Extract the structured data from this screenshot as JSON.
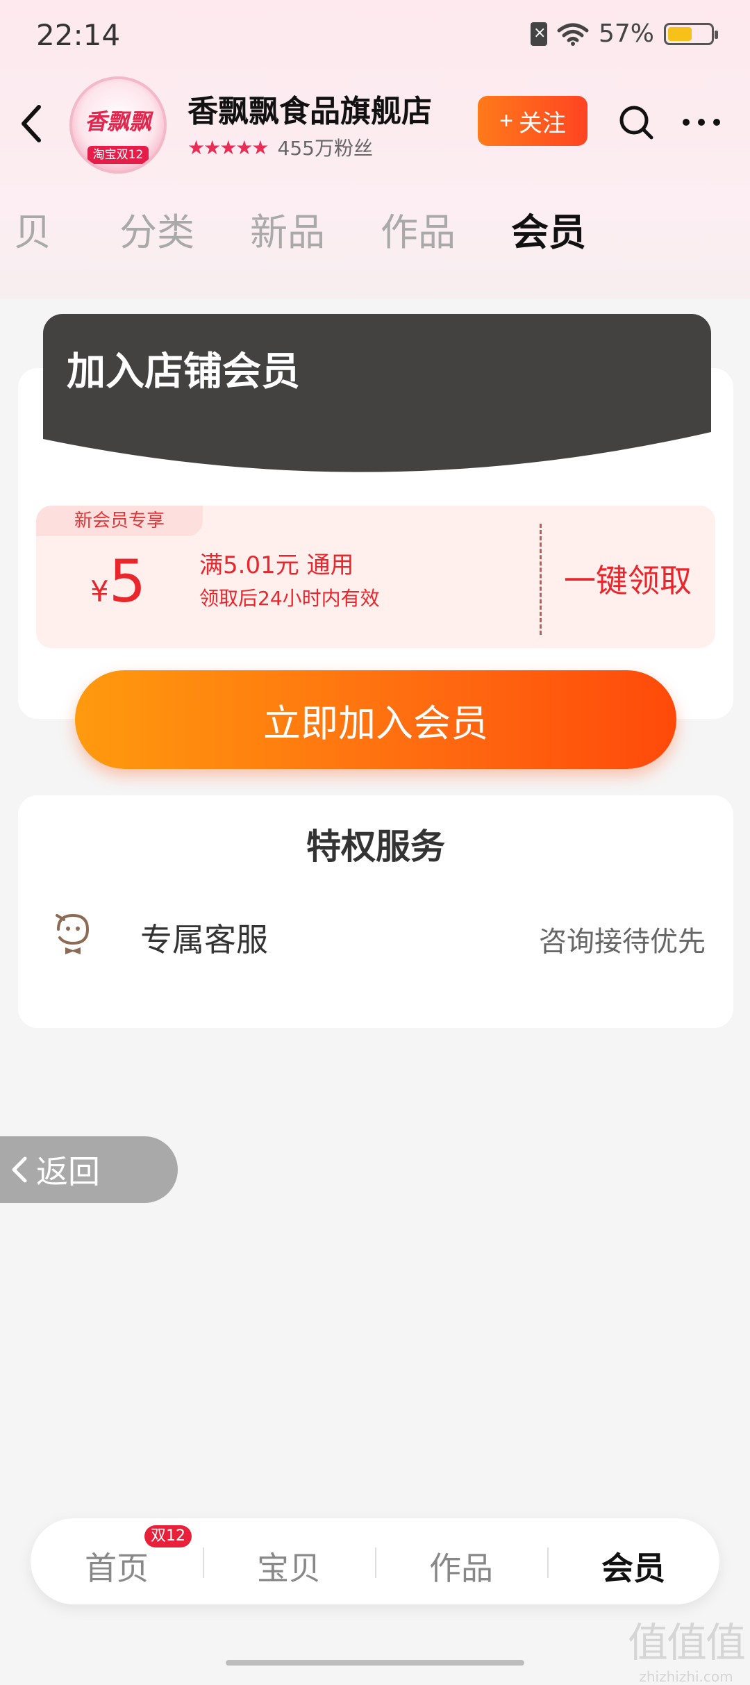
{
  "status_bar": {
    "time": "22:14",
    "battery_percent": "57%",
    "battery_level": 0.57,
    "icons": [
      "sim-error-icon",
      "wifi-icon",
      "battery-icon"
    ]
  },
  "store": {
    "logo_text": "香飘飘",
    "logo_badge": "淘宝双12",
    "name": "香飘飘食品旗舰店",
    "rating_stars": 5,
    "fans": "455万粉丝",
    "follow_label": "关注",
    "follow_prefix": "+"
  },
  "tabs": [
    {
      "label": "贝",
      "active": false
    },
    {
      "label": "分类",
      "active": false
    },
    {
      "label": "新品",
      "active": false
    },
    {
      "label": "作品",
      "active": false
    },
    {
      "label": "会员",
      "active": true
    }
  ],
  "join": {
    "banner_title": "加入店铺会员",
    "coupon": {
      "tag": "新会员专享",
      "currency": "¥",
      "amount": "5",
      "condition": "满5.01元 通用",
      "validity": "领取后24小时内有效",
      "claim_label": "一键领取"
    },
    "join_button": "立即加入会员"
  },
  "privileges": {
    "title": "特权服务",
    "items": [
      {
        "name": "专属客服",
        "desc": "咨询接待优先",
        "icon": "customer-service-icon"
      }
    ]
  },
  "float_back": "返回",
  "bottom_nav": {
    "items": [
      {
        "label": "首页",
        "badge": "双12",
        "active": false
      },
      {
        "label": "宝贝",
        "active": false
      },
      {
        "label": "作品",
        "active": false
      },
      {
        "label": "会员",
        "active": true
      }
    ]
  },
  "watermark": {
    "glyphs": "值值值",
    "url": "zhizhizhi.com"
  },
  "colors": {
    "accent_orange": "#ff6a10",
    "coupon_red": "#e8262c",
    "banner_dark": "#444141"
  }
}
